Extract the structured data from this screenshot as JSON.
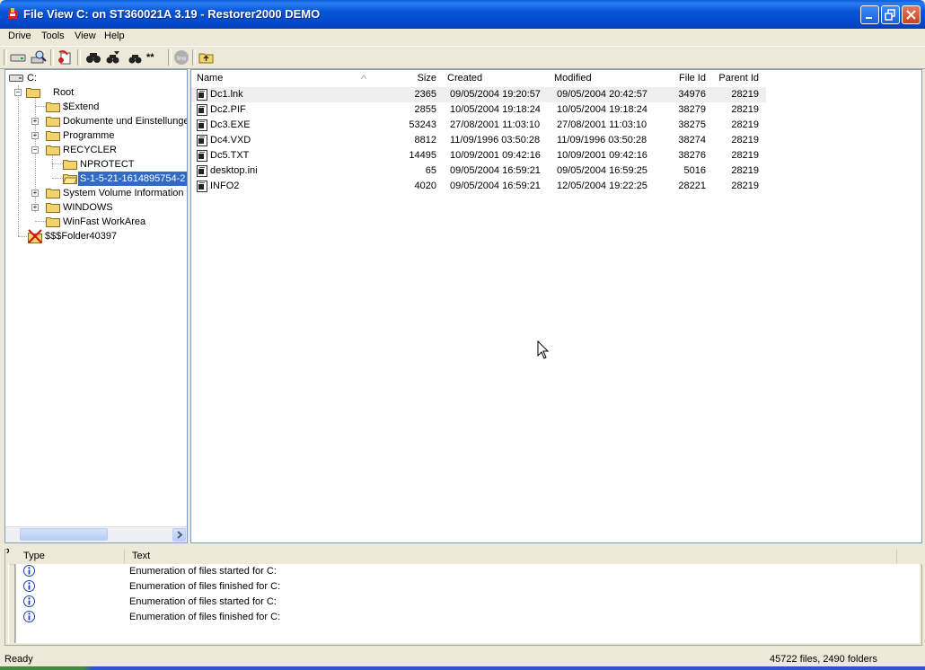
{
  "window": {
    "title": "File View C: on ST360021A 3.19 - Restorer2000 DEMO"
  },
  "menu": [
    "Drive",
    "Tools",
    "View",
    "Help"
  ],
  "toolbar": {
    "icons": [
      "drive-icon",
      "scan-icon",
      "recover-icon",
      "find-icon",
      "find-next-icon",
      "find-mask-icon",
      "stop-icon",
      "folder-up-icon"
    ],
    "stop_label": "Stop"
  },
  "tree": {
    "drive": "C:",
    "root": "Root",
    "nodes": [
      "$Extend",
      "Dokumente und Einstellungen",
      "Programme",
      "RECYCLER",
      "NPROTECT",
      "S-1-5-21-1614895754-2",
      "System Volume Information",
      "WINDOWS",
      "WinFast WorkArea"
    ],
    "orphan": "$$$Folder40397"
  },
  "list": {
    "headers": {
      "name": "Name",
      "size": "Size",
      "created": "Created",
      "modified": "Modified",
      "file_id": "File Id",
      "parent_id": "Parent Id"
    },
    "rows": [
      {
        "name": "Dc1.lnk",
        "size": "2365",
        "created": "09/05/2004 19:20:57",
        "modified": "09/05/2004 20:42:57",
        "file_id": "34976",
        "parent_id": "28219"
      },
      {
        "name": "Dc2.PIF",
        "size": "2855",
        "created": "10/05/2004 19:18:24",
        "modified": "10/05/2004 19:18:24",
        "file_id": "38279",
        "parent_id": "28219"
      },
      {
        "name": "Dc3.EXE",
        "size": "53243",
        "created": "27/08/2001 11:03:10",
        "modified": "27/08/2001 11:03:10",
        "file_id": "38275",
        "parent_id": "28219"
      },
      {
        "name": "Dc4.VXD",
        "size": "8812",
        "created": "11/09/1996 03:50:28",
        "modified": "11/09/1996 03:50:28",
        "file_id": "38274",
        "parent_id": "28219"
      },
      {
        "name": "Dc5.TXT",
        "size": "14495",
        "created": "10/09/2001 09:42:16",
        "modified": "10/09/2001 09:42:16",
        "file_id": "38276",
        "parent_id": "28219"
      },
      {
        "name": "desktop.ini",
        "size": "65",
        "created": "09/05/2004 16:59:21",
        "modified": "09/05/2004 16:59:25",
        "file_id": "5016",
        "parent_id": "28219"
      },
      {
        "name": "INFO2",
        "size": "4020",
        "created": "09/05/2004 16:59:21",
        "modified": "12/05/2004 19:22:25",
        "file_id": "28221",
        "parent_id": "28219"
      }
    ]
  },
  "log": {
    "close": "×",
    "headers": {
      "type": "Type",
      "text": "Text"
    },
    "rows": [
      "Enumeration of files started for C:",
      "Enumeration of files finished for C:",
      "Enumeration of files started for C:",
      "Enumeration of files finished for C:"
    ]
  },
  "status": {
    "left": "Ready",
    "right": "45722 files, 2490 folders"
  },
  "colors": {
    "title_bar": "#0a52d8",
    "selection": "#316ac5",
    "window_bg": "#ece9d8"
  }
}
